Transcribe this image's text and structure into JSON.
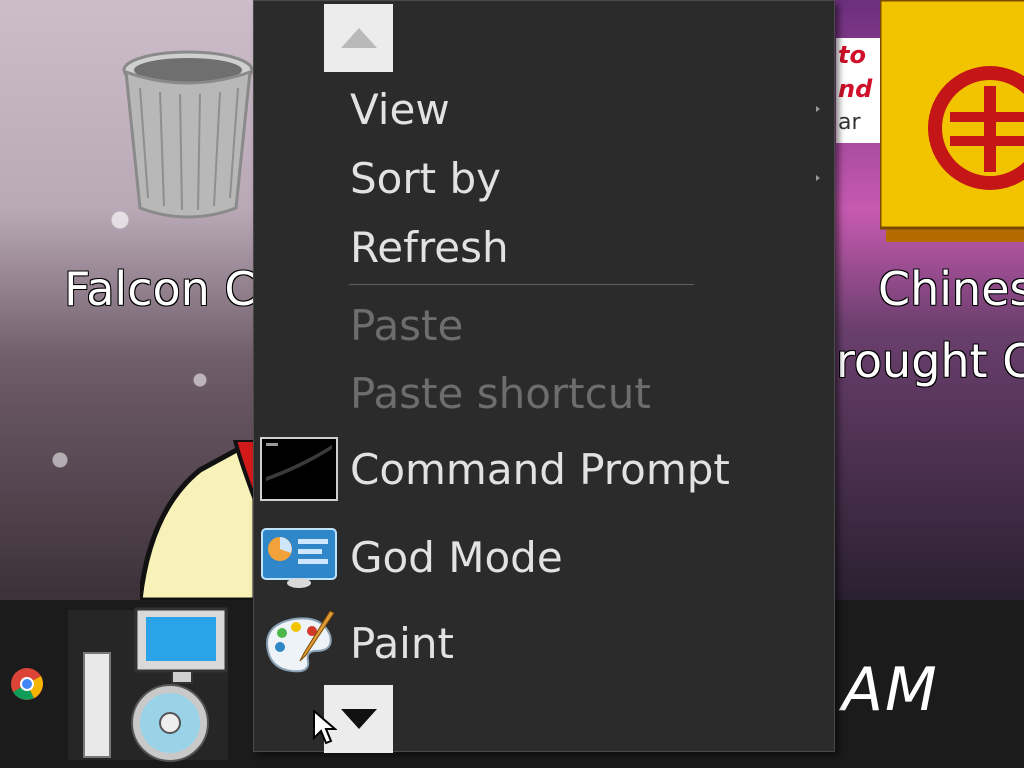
{
  "desktop": {
    "icons": [
      {
        "label": "Falcon C",
        "name": "Falcon C"
      },
      {
        "label_line1": "Chines",
        "label_line2": "rought C"
      }
    ],
    "promo_lines": [
      "to e",
      "nd",
      "ar"
    ]
  },
  "context_menu": {
    "items": [
      {
        "label": "View",
        "has_submenu": true,
        "enabled": true
      },
      {
        "label": "Sort by",
        "has_submenu": true,
        "enabled": true
      },
      {
        "label": "Refresh",
        "has_submenu": false,
        "enabled": true
      },
      {
        "label": "Paste",
        "has_submenu": false,
        "enabled": false
      },
      {
        "label": "Paste shortcut",
        "has_submenu": false,
        "enabled": false
      },
      {
        "label": "Command Prompt",
        "icon": "command-prompt-icon",
        "enabled": true
      },
      {
        "label": "God Mode",
        "icon": "control-panel-icon",
        "enabled": true
      },
      {
        "label": "Paint",
        "icon": "paint-palette-icon",
        "enabled": true
      }
    ],
    "scroll_up_icon": "triangle-up-icon",
    "scroll_down_icon": "triangle-down-icon"
  },
  "taskbar": {
    "clock_text": "AM",
    "icons": [
      "chrome-icon",
      "setup-installer-icon"
    ]
  },
  "colors": {
    "menu_bg": "#2b2b2b",
    "menu_text": "#e2e2e2",
    "menu_disabled_text": "#6d6d6d",
    "taskbar_bg": "#1b1b1b"
  }
}
